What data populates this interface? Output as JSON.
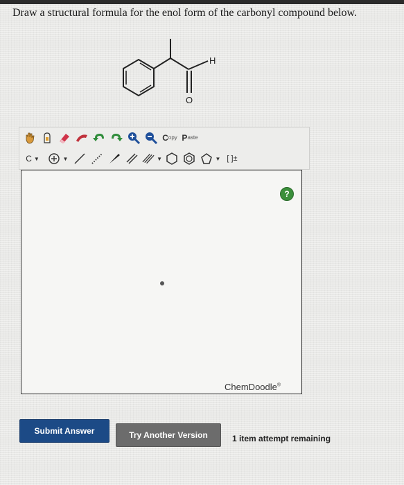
{
  "question": {
    "text": "Draw a structural formula for the enol form of the carbonyl compound below."
  },
  "molecule": {
    "label_h": "H",
    "label_o": "O"
  },
  "toolbar": {
    "copy_big": "C",
    "copy_small": "opy",
    "paste_big": "P",
    "paste_small": "aste",
    "element_label": "C",
    "charge_label": "[ ]±"
  },
  "canvas": {
    "help_label": "?",
    "brand": "ChemDoodle",
    "brand_mark": "®"
  },
  "buttons": {
    "submit": "Submit Answer",
    "try_another": "Try Another Version"
  },
  "status": {
    "attempts": "1 item attempt remaining"
  },
  "colors": {
    "submit_bg": "#1c4a86",
    "try_bg": "#6c6c6c",
    "help_bg": "#3b8f3b"
  }
}
